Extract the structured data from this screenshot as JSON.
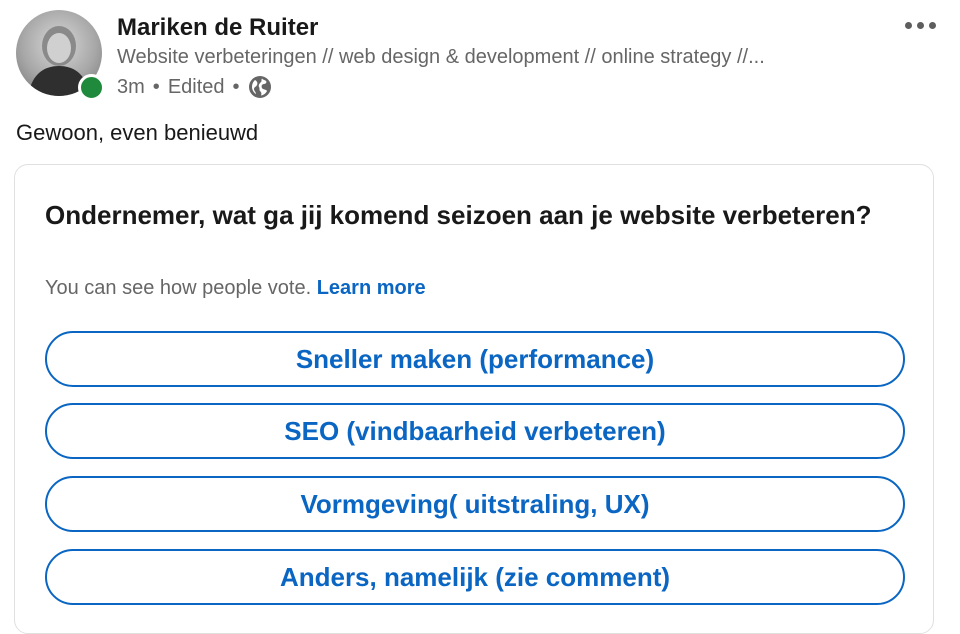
{
  "post": {
    "author": {
      "name": "Mariken de Ruiter",
      "headline": "Website verbeteringen // web design & development // online strategy //...",
      "status_color": "#1f8a3b"
    },
    "meta": {
      "time": "3m",
      "edited": "Edited",
      "separator": "•",
      "visibility_icon": "globe-icon"
    },
    "more_icon": "ellipsis-icon",
    "text": "Gewoon, even benieuwd"
  },
  "poll": {
    "question": "Ondernemer, wat ga jij komend seizoen aan je website verbeteren?",
    "note": "You can see how people vote.",
    "learn_more": "Learn more",
    "options": [
      {
        "label": "Sneller maken (performance)"
      },
      {
        "label": "SEO (vindbaarheid verbeteren)"
      },
      {
        "label": "Vormgeving( uitstraling, UX)"
      },
      {
        "label": "Anders, namelijk (zie comment)"
      }
    ],
    "accent_color": "#0a66c2"
  }
}
